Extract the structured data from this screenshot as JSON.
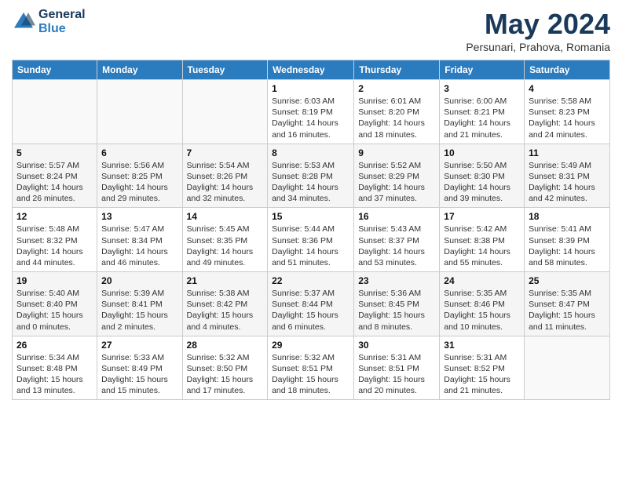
{
  "header": {
    "logo_line1": "General",
    "logo_line2": "Blue",
    "month_title": "May 2024",
    "subtitle": "Persunari, Prahova, Romania"
  },
  "calendar": {
    "days_of_week": [
      "Sunday",
      "Monday",
      "Tuesday",
      "Wednesday",
      "Thursday",
      "Friday",
      "Saturday"
    ],
    "weeks": [
      [
        {
          "day": "",
          "info": ""
        },
        {
          "day": "",
          "info": ""
        },
        {
          "day": "",
          "info": ""
        },
        {
          "day": "1",
          "info": "Sunrise: 6:03 AM\nSunset: 8:19 PM\nDaylight: 14 hours\nand 16 minutes."
        },
        {
          "day": "2",
          "info": "Sunrise: 6:01 AM\nSunset: 8:20 PM\nDaylight: 14 hours\nand 18 minutes."
        },
        {
          "day": "3",
          "info": "Sunrise: 6:00 AM\nSunset: 8:21 PM\nDaylight: 14 hours\nand 21 minutes."
        },
        {
          "day": "4",
          "info": "Sunrise: 5:58 AM\nSunset: 8:23 PM\nDaylight: 14 hours\nand 24 minutes."
        }
      ],
      [
        {
          "day": "5",
          "info": "Sunrise: 5:57 AM\nSunset: 8:24 PM\nDaylight: 14 hours\nand 26 minutes."
        },
        {
          "day": "6",
          "info": "Sunrise: 5:56 AM\nSunset: 8:25 PM\nDaylight: 14 hours\nand 29 minutes."
        },
        {
          "day": "7",
          "info": "Sunrise: 5:54 AM\nSunset: 8:26 PM\nDaylight: 14 hours\nand 32 minutes."
        },
        {
          "day": "8",
          "info": "Sunrise: 5:53 AM\nSunset: 8:28 PM\nDaylight: 14 hours\nand 34 minutes."
        },
        {
          "day": "9",
          "info": "Sunrise: 5:52 AM\nSunset: 8:29 PM\nDaylight: 14 hours\nand 37 minutes."
        },
        {
          "day": "10",
          "info": "Sunrise: 5:50 AM\nSunset: 8:30 PM\nDaylight: 14 hours\nand 39 minutes."
        },
        {
          "day": "11",
          "info": "Sunrise: 5:49 AM\nSunset: 8:31 PM\nDaylight: 14 hours\nand 42 minutes."
        }
      ],
      [
        {
          "day": "12",
          "info": "Sunrise: 5:48 AM\nSunset: 8:32 PM\nDaylight: 14 hours\nand 44 minutes."
        },
        {
          "day": "13",
          "info": "Sunrise: 5:47 AM\nSunset: 8:34 PM\nDaylight: 14 hours\nand 46 minutes."
        },
        {
          "day": "14",
          "info": "Sunrise: 5:45 AM\nSunset: 8:35 PM\nDaylight: 14 hours\nand 49 minutes."
        },
        {
          "day": "15",
          "info": "Sunrise: 5:44 AM\nSunset: 8:36 PM\nDaylight: 14 hours\nand 51 minutes."
        },
        {
          "day": "16",
          "info": "Sunrise: 5:43 AM\nSunset: 8:37 PM\nDaylight: 14 hours\nand 53 minutes."
        },
        {
          "day": "17",
          "info": "Sunrise: 5:42 AM\nSunset: 8:38 PM\nDaylight: 14 hours\nand 55 minutes."
        },
        {
          "day": "18",
          "info": "Sunrise: 5:41 AM\nSunset: 8:39 PM\nDaylight: 14 hours\nand 58 minutes."
        }
      ],
      [
        {
          "day": "19",
          "info": "Sunrise: 5:40 AM\nSunset: 8:40 PM\nDaylight: 15 hours\nand 0 minutes."
        },
        {
          "day": "20",
          "info": "Sunrise: 5:39 AM\nSunset: 8:41 PM\nDaylight: 15 hours\nand 2 minutes."
        },
        {
          "day": "21",
          "info": "Sunrise: 5:38 AM\nSunset: 8:42 PM\nDaylight: 15 hours\nand 4 minutes."
        },
        {
          "day": "22",
          "info": "Sunrise: 5:37 AM\nSunset: 8:44 PM\nDaylight: 15 hours\nand 6 minutes."
        },
        {
          "day": "23",
          "info": "Sunrise: 5:36 AM\nSunset: 8:45 PM\nDaylight: 15 hours\nand 8 minutes."
        },
        {
          "day": "24",
          "info": "Sunrise: 5:35 AM\nSunset: 8:46 PM\nDaylight: 15 hours\nand 10 minutes."
        },
        {
          "day": "25",
          "info": "Sunrise: 5:35 AM\nSunset: 8:47 PM\nDaylight: 15 hours\nand 11 minutes."
        }
      ],
      [
        {
          "day": "26",
          "info": "Sunrise: 5:34 AM\nSunset: 8:48 PM\nDaylight: 15 hours\nand 13 minutes."
        },
        {
          "day": "27",
          "info": "Sunrise: 5:33 AM\nSunset: 8:49 PM\nDaylight: 15 hours\nand 15 minutes."
        },
        {
          "day": "28",
          "info": "Sunrise: 5:32 AM\nSunset: 8:50 PM\nDaylight: 15 hours\nand 17 minutes."
        },
        {
          "day": "29",
          "info": "Sunrise: 5:32 AM\nSunset: 8:51 PM\nDaylight: 15 hours\nand 18 minutes."
        },
        {
          "day": "30",
          "info": "Sunrise: 5:31 AM\nSunset: 8:51 PM\nDaylight: 15 hours\nand 20 minutes."
        },
        {
          "day": "31",
          "info": "Sunrise: 5:31 AM\nSunset: 8:52 PM\nDaylight: 15 hours\nand 21 minutes."
        },
        {
          "day": "",
          "info": ""
        }
      ]
    ]
  }
}
